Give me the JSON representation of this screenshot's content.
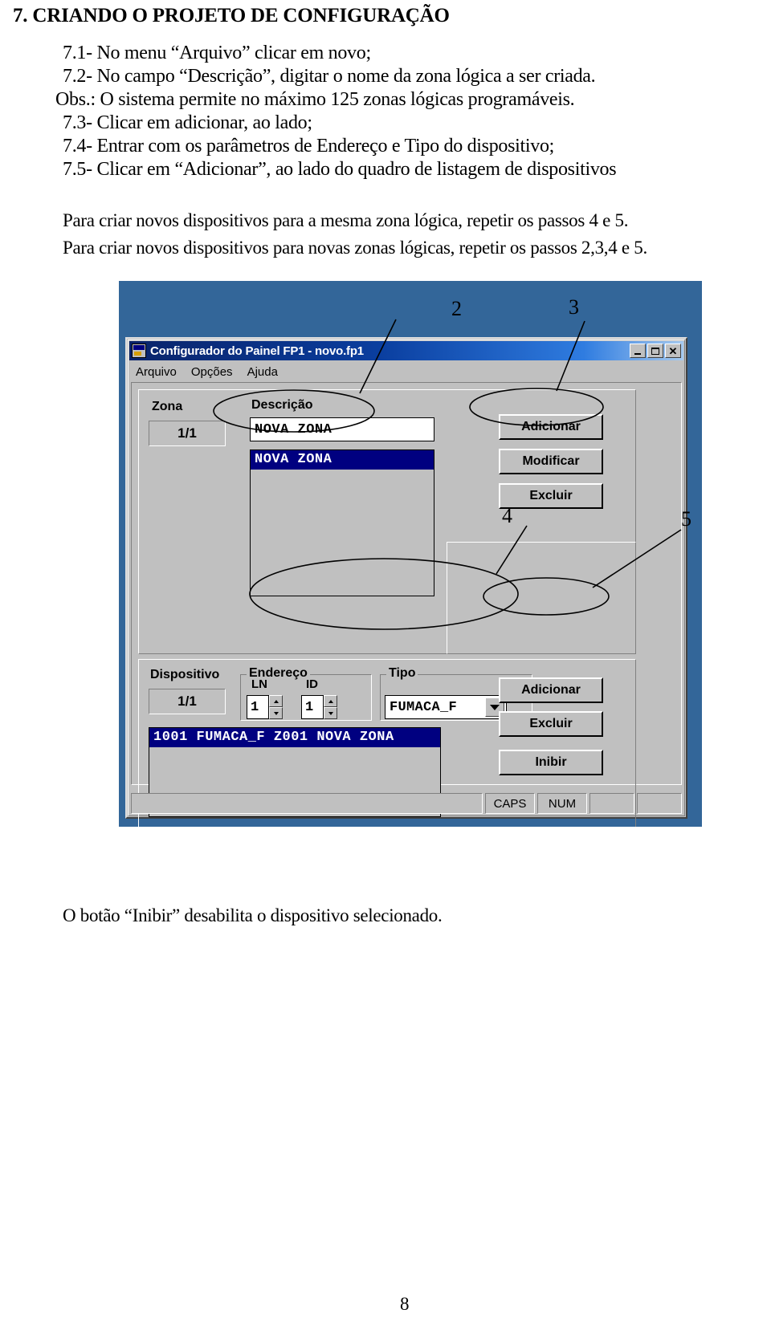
{
  "document": {
    "title": "7.  CRIANDO O PROJETO DE CONFIGURAÇÃO",
    "steps": [
      "7.1- No menu “Arquivo” clicar em novo;",
      "7.2- No campo “Descrição”, digitar o nome da zona lógica a ser criada.",
      "Obs.: O sistema permite no máximo 125 zonas lógicas programáveis.",
      "7.3- Clicar em adicionar, ao lado;",
      "7.4- Entrar com os parâmetros de Endereço e Tipo do dispositivo;",
      "7.5- Clicar em “Adicionar”, ao lado do quadro de listagem de dispositivos"
    ],
    "notes": [
      "Para criar novos dispositivos para a mesma zona lógica, repetir os passos 4 e 5.",
      "Para criar novos dispositivos para novas zonas lógicas, repetir os passos 2,3,4 e 5."
    ],
    "footnote": "O botão “Inibir” desabilita o dispositivo selecionado.",
    "page_number": "8"
  },
  "screenshot": {
    "desktop_color": "#336699",
    "window": {
      "title": "Configurador do Painel FP1 - novo.fp1",
      "title_icon": "app-icon",
      "titlebar_buttons": [
        {
          "name": "minimize",
          "glyph": "_"
        },
        {
          "name": "maximize",
          "glyph": "□"
        },
        {
          "name": "close",
          "glyph": "✕"
        }
      ],
      "menu": [
        "Arquivo",
        "Opções",
        "Ajuda"
      ],
      "zone_section": {
        "zona_label": "Zona",
        "zona_counter": "1/1",
        "descricao_label": "Descrição",
        "descricao_value": "NOVA ZONA",
        "list_selected": "NOVA ZONA",
        "buttons": [
          "Adicionar",
          "Modificar",
          "Excluir"
        ]
      },
      "device_section": {
        "dispositivo_label": "Dispositivo",
        "dispositivo_counter": "1/1",
        "endereco_label": "Endereço",
        "ln_label": "LN",
        "id_label": "ID",
        "ln_value": "1",
        "id_value": "1",
        "tipo_label": "Tipo",
        "tipo_value": "FUMACA_F",
        "list_selected": "1001 FUMACA_F Z001 NOVA ZONA",
        "buttons": [
          "Adicionar",
          "Excluir",
          "Inibir"
        ]
      },
      "statusbar": {
        "message": "",
        "caps": "CAPS",
        "num": "NUM",
        "extra1": "",
        "extra2": ""
      }
    },
    "callouts": [
      {
        "label": "2"
      },
      {
        "label": "3"
      },
      {
        "label": "4"
      },
      {
        "label": "5"
      }
    ]
  }
}
